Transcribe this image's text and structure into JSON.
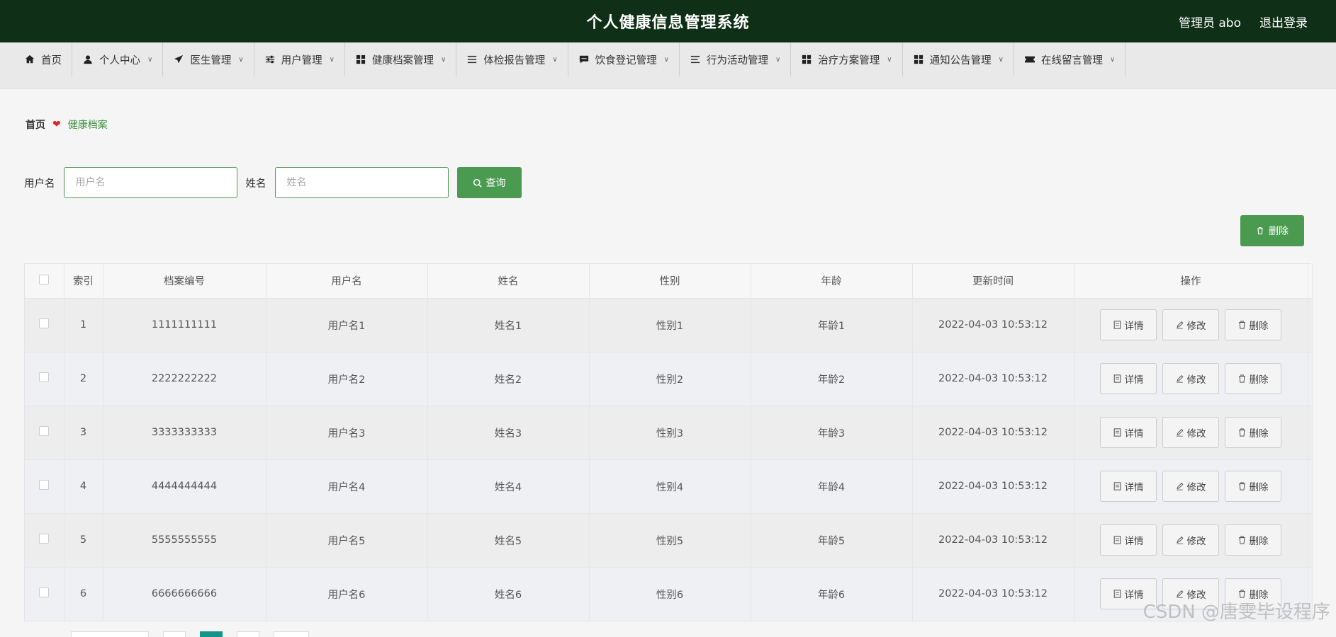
{
  "header": {
    "title": "个人健康信息管理系统",
    "user": "管理员 abo",
    "logout": "退出登录"
  },
  "nav": [
    {
      "label": "首页",
      "icon": "home-icon",
      "dropdown": false
    },
    {
      "label": "个人中心",
      "icon": "user-icon",
      "dropdown": true
    },
    {
      "label": "医生管理",
      "icon": "paper-plane-icon",
      "dropdown": true
    },
    {
      "label": "用户管理",
      "icon": "sliders-icon",
      "dropdown": true
    },
    {
      "label": "健康档案管理",
      "icon": "grid-icon",
      "dropdown": true
    },
    {
      "label": "体检报告管理",
      "icon": "list-icon",
      "dropdown": true
    },
    {
      "label": "饮食登记管理",
      "icon": "chat-icon",
      "dropdown": true
    },
    {
      "label": "行为活动管理",
      "icon": "lines-icon",
      "dropdown": true
    },
    {
      "label": "治疗方案管理",
      "icon": "grid-icon",
      "dropdown": true
    },
    {
      "label": "通知公告管理",
      "icon": "grid-icon",
      "dropdown": true
    },
    {
      "label": "在线留言管理",
      "icon": "ticket-icon",
      "dropdown": true
    }
  ],
  "breadcrumb": {
    "home": "首页",
    "current": "健康档案"
  },
  "search": {
    "username_label": "用户名",
    "username_placeholder": "用户名",
    "name_label": "姓名",
    "name_placeholder": "姓名",
    "query_button": "查询"
  },
  "delete_button": "删除",
  "table": {
    "columns": [
      "索引",
      "档案编号",
      "用户名",
      "姓名",
      "性别",
      "年龄",
      "更新时间",
      "操作"
    ],
    "rows": [
      {
        "index": "1",
        "code": "1111111111",
        "username": "用户名1",
        "name": "姓名1",
        "gender": "性别1",
        "age": "年龄1",
        "updated": "2022-04-03 10:53:12"
      },
      {
        "index": "2",
        "code": "2222222222",
        "username": "用户名2",
        "name": "姓名2",
        "gender": "性别2",
        "age": "年龄2",
        "updated": "2022-04-03 10:53:12"
      },
      {
        "index": "3",
        "code": "3333333333",
        "username": "用户名3",
        "name": "姓名3",
        "gender": "性别3",
        "age": "年龄3",
        "updated": "2022-04-03 10:53:12"
      },
      {
        "index": "4",
        "code": "4444444444",
        "username": "用户名4",
        "name": "姓名4",
        "gender": "性别4",
        "age": "年龄4",
        "updated": "2022-04-03 10:53:12"
      },
      {
        "index": "5",
        "code": "5555555555",
        "username": "用户名5",
        "name": "姓名5",
        "gender": "性别5",
        "age": "年龄5",
        "updated": "2022-04-03 10:53:12"
      },
      {
        "index": "6",
        "code": "6666666666",
        "username": "用户名6",
        "name": "姓名6",
        "gender": "性别6",
        "age": "年龄6",
        "updated": "2022-04-03 10:53:12"
      }
    ],
    "actions": {
      "detail": "详情",
      "edit": "修改",
      "delete": "删除"
    }
  },
  "watermark": "CSDN @唐雯毕设程序",
  "colors": {
    "header_bg": "#0f2f16",
    "accent_green": "#4a9b50",
    "pager_active": "#18938a"
  }
}
